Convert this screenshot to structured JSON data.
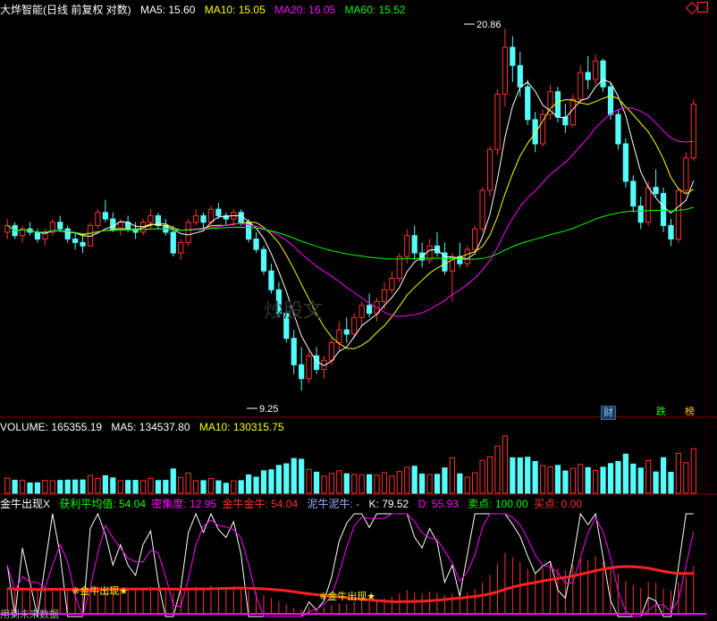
{
  "main_header": {
    "title": "大烨智能(日线 前复权 对数)",
    "ma5": "MA5: 15.60",
    "ma10": "MA10: 15.05",
    "ma20": "MA20: 16.05",
    "ma60": "MA60: 15.52"
  },
  "price_high_label": "20.86",
  "price_low_label": "9.25",
  "watermark": "炒股文",
  "volume_header": {
    "volume": "VOLUME: 165355.19",
    "ma5": "MA5: 134537.80",
    "ma10": "MA10: 130315.75"
  },
  "indicator_header": {
    "name": "金牛出现X",
    "profit_avg": "获利平均值: 54.04",
    "density": "密集度: 12.95",
    "golden_bull": "金牛金牛: 54.04",
    "mud_bull": "泥牛泥牛: -",
    "k": "K: 79.52",
    "d": "D: 55.93",
    "sell_point": "卖点: 100.00",
    "buy_point": "买点: 0.00"
  },
  "signals": {
    "golden_bull_1": "※金牛出现★",
    "golden_bull_2": "※金牛出现★",
    "bottom_text": "用到未来数据"
  },
  "buttons": {
    "finance": "财",
    "limit_down": "跌",
    "leaderboard": "榜"
  },
  "colors": {
    "background": "#000000",
    "up": "#ff3232",
    "down": "#54fcfc",
    "ma5": "#ffffff",
    "ma10": "#ffff00",
    "ma20": "#ff00ff",
    "ma60": "#00ff00"
  },
  "chart_data": {
    "type": "candlestick",
    "scale": "log",
    "y_marks": {
      "high": 20.86,
      "low": 9.25
    },
    "ohlc": [
      [
        13.2,
        13.6,
        13.0,
        13.4
      ],
      [
        13.4,
        13.5,
        13.0,
        13.1
      ],
      [
        13.1,
        13.4,
        12.9,
        13.3
      ],
      [
        13.3,
        13.5,
        13.1,
        13.2
      ],
      [
        13.2,
        13.3,
        12.9,
        13.0
      ],
      [
        13.0,
        13.3,
        12.8,
        13.2
      ],
      [
        13.2,
        13.6,
        13.1,
        13.5
      ],
      [
        13.5,
        13.7,
        13.2,
        13.3
      ],
      [
        13.3,
        13.4,
        12.9,
        13.0
      ],
      [
        13.0,
        13.2,
        12.7,
        12.9
      ],
      [
        12.9,
        13.1,
        12.6,
        12.8
      ],
      [
        12.8,
        13.5,
        12.8,
        13.4
      ],
      [
        13.4,
        13.9,
        13.3,
        13.8
      ],
      [
        13.8,
        14.2,
        13.5,
        13.6
      ],
      [
        13.6,
        13.8,
        13.2,
        13.3
      ],
      [
        13.3,
        13.6,
        13.1,
        13.5
      ],
      [
        13.5,
        13.7,
        13.2,
        13.3
      ],
      [
        13.3,
        13.5,
        13.0,
        13.2
      ],
      [
        13.2,
        13.6,
        13.1,
        13.5
      ],
      [
        13.5,
        13.9,
        13.3,
        13.7
      ],
      [
        13.7,
        13.8,
        13.3,
        13.4
      ],
      [
        13.4,
        13.6,
        13.1,
        13.2
      ],
      [
        13.2,
        13.4,
        12.5,
        12.6
      ],
      [
        12.6,
        13.0,
        12.4,
        12.9
      ],
      [
        12.9,
        13.6,
        12.8,
        13.5
      ],
      [
        13.5,
        13.9,
        13.4,
        13.7
      ],
      [
        13.7,
        13.8,
        13.3,
        13.5
      ],
      [
        13.5,
        14.0,
        13.4,
        13.9
      ],
      [
        13.9,
        14.1,
        13.6,
        13.7
      ],
      [
        13.7,
        13.8,
        13.4,
        13.6
      ],
      [
        13.6,
        13.9,
        13.4,
        13.8
      ],
      [
        13.8,
        13.9,
        13.4,
        13.5
      ],
      [
        13.5,
        13.6,
        12.9,
        13.0
      ],
      [
        13.0,
        13.2,
        12.6,
        12.7
      ],
      [
        12.7,
        12.8,
        12.0,
        12.1
      ],
      [
        12.1,
        12.3,
        11.5,
        11.6
      ],
      [
        11.6,
        11.8,
        10.9,
        11.0
      ],
      [
        11.0,
        11.2,
        10.3,
        10.4
      ],
      [
        10.4,
        10.6,
        9.6,
        9.8
      ],
      [
        9.8,
        10.2,
        9.25,
        9.5
      ],
      [
        9.5,
        10.1,
        9.4,
        10.0
      ],
      [
        10.0,
        10.2,
        9.6,
        9.7
      ],
      [
        9.7,
        10.0,
        9.5,
        9.9
      ],
      [
        9.9,
        10.4,
        9.8,
        10.3
      ],
      [
        10.3,
        10.8,
        10.1,
        10.6
      ],
      [
        10.6,
        10.9,
        10.3,
        10.5
      ],
      [
        10.5,
        11.0,
        10.4,
        10.9
      ],
      [
        10.9,
        11.3,
        10.7,
        11.2
      ],
      [
        11.2,
        11.5,
        10.9,
        11.0
      ],
      [
        11.0,
        11.4,
        10.8,
        11.3
      ],
      [
        11.3,
        11.8,
        11.1,
        11.6
      ],
      [
        11.6,
        12.1,
        11.5,
        11.9
      ],
      [
        11.9,
        12.6,
        11.8,
        12.5
      ],
      [
        12.5,
        13.3,
        12.3,
        13.1
      ],
      [
        13.1,
        13.4,
        12.4,
        12.6
      ],
      [
        12.6,
        12.9,
        12.2,
        12.4
      ],
      [
        12.4,
        13.0,
        12.3,
        12.8
      ],
      [
        12.8,
        13.2,
        12.5,
        12.6
      ],
      [
        12.6,
        12.9,
        12.0,
        12.1
      ],
      [
        12.1,
        12.6,
        11.3,
        12.5
      ],
      [
        12.5,
        12.9,
        12.2,
        12.3
      ],
      [
        12.3,
        12.8,
        12.2,
        12.7
      ],
      [
        12.7,
        13.4,
        12.6,
        13.3
      ],
      [
        13.3,
        14.6,
        13.2,
        14.5
      ],
      [
        14.5,
        16.0,
        14.3,
        15.9
      ],
      [
        15.9,
        18.2,
        15.7,
        18.0
      ],
      [
        18.0,
        20.86,
        17.5,
        20.0
      ],
      [
        20.0,
        20.5,
        18.5,
        19.2
      ],
      [
        19.2,
        19.8,
        17.9,
        18.3
      ],
      [
        18.3,
        18.6,
        16.8,
        17.0
      ],
      [
        17.0,
        17.3,
        15.8,
        16.1
      ],
      [
        16.1,
        17.4,
        16.0,
        17.2
      ],
      [
        17.2,
        18.4,
        17.0,
        18.1
      ],
      [
        18.1,
        18.3,
        16.9,
        17.1
      ],
      [
        17.1,
        17.6,
        16.5,
        16.8
      ],
      [
        16.8,
        18.0,
        16.7,
        17.8
      ],
      [
        17.8,
        19.2,
        17.6,
        18.9
      ],
      [
        18.9,
        19.6,
        18.2,
        18.6
      ],
      [
        18.6,
        19.7,
        18.4,
        19.4
      ],
      [
        19.4,
        19.5,
        18.1,
        18.3
      ],
      [
        18.3,
        18.5,
        17.0,
        17.2
      ],
      [
        17.2,
        17.4,
        15.9,
        16.1
      ],
      [
        16.1,
        16.3,
        14.6,
        14.8
      ],
      [
        14.8,
        15.0,
        13.8,
        14.0
      ],
      [
        14.0,
        14.3,
        13.3,
        13.5
      ],
      [
        13.5,
        14.8,
        13.4,
        14.6
      ],
      [
        14.6,
        15.2,
        14.3,
        14.4
      ],
      [
        14.4,
        14.6,
        13.2,
        13.4
      ],
      [
        13.4,
        13.6,
        12.8,
        13.0
      ],
      [
        13.0,
        14.6,
        12.9,
        14.5
      ],
      [
        14.5,
        15.8,
        14.4,
        15.6
      ],
      [
        15.6,
        17.8,
        15.5,
        17.6
      ]
    ]
  }
}
